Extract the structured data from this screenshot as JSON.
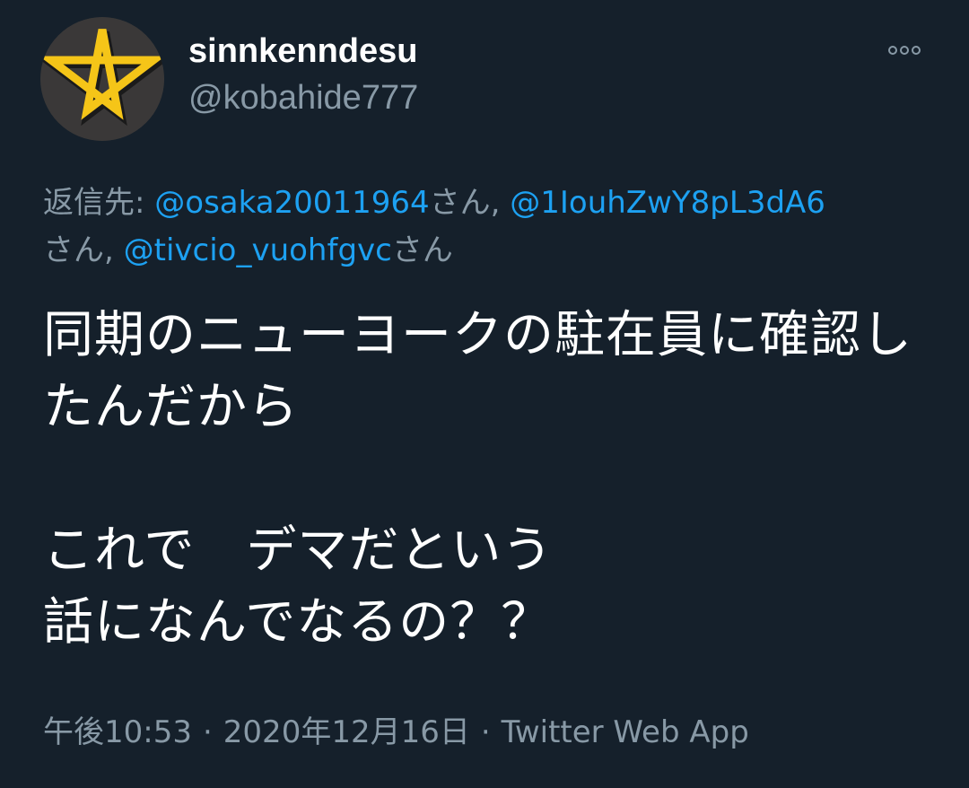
{
  "tweet": {
    "author": {
      "display_name": "sinnkenndesu",
      "handle": "@kobahide777",
      "avatar_icon": "pentagram-icon"
    },
    "more_icon": "more-options-icon",
    "reply_to": {
      "prefix": "返信先: ",
      "mentions": [
        {
          "handle": "@osaka20011964",
          "suffix": "さん, "
        },
        {
          "handle": "@1IouhZwY8pL3dA6",
          "suffix": "さん, "
        },
        {
          "handle": "@tivcio_vuohfgvc",
          "suffix": "さん"
        }
      ]
    },
    "text": "同期のニューヨークの駐在員に確認したんだから\n\nこれで　デマだという\n話になんでなるの？？",
    "meta": {
      "time": "午後10:53",
      "separator": "·",
      "date": "2020年12月16日",
      "source": "Twitter Web App"
    }
  },
  "colors": {
    "background": "#15202b",
    "text": "#ffffff",
    "muted": "#8899a6",
    "link": "#1da1f2",
    "star": "#f5c518"
  }
}
